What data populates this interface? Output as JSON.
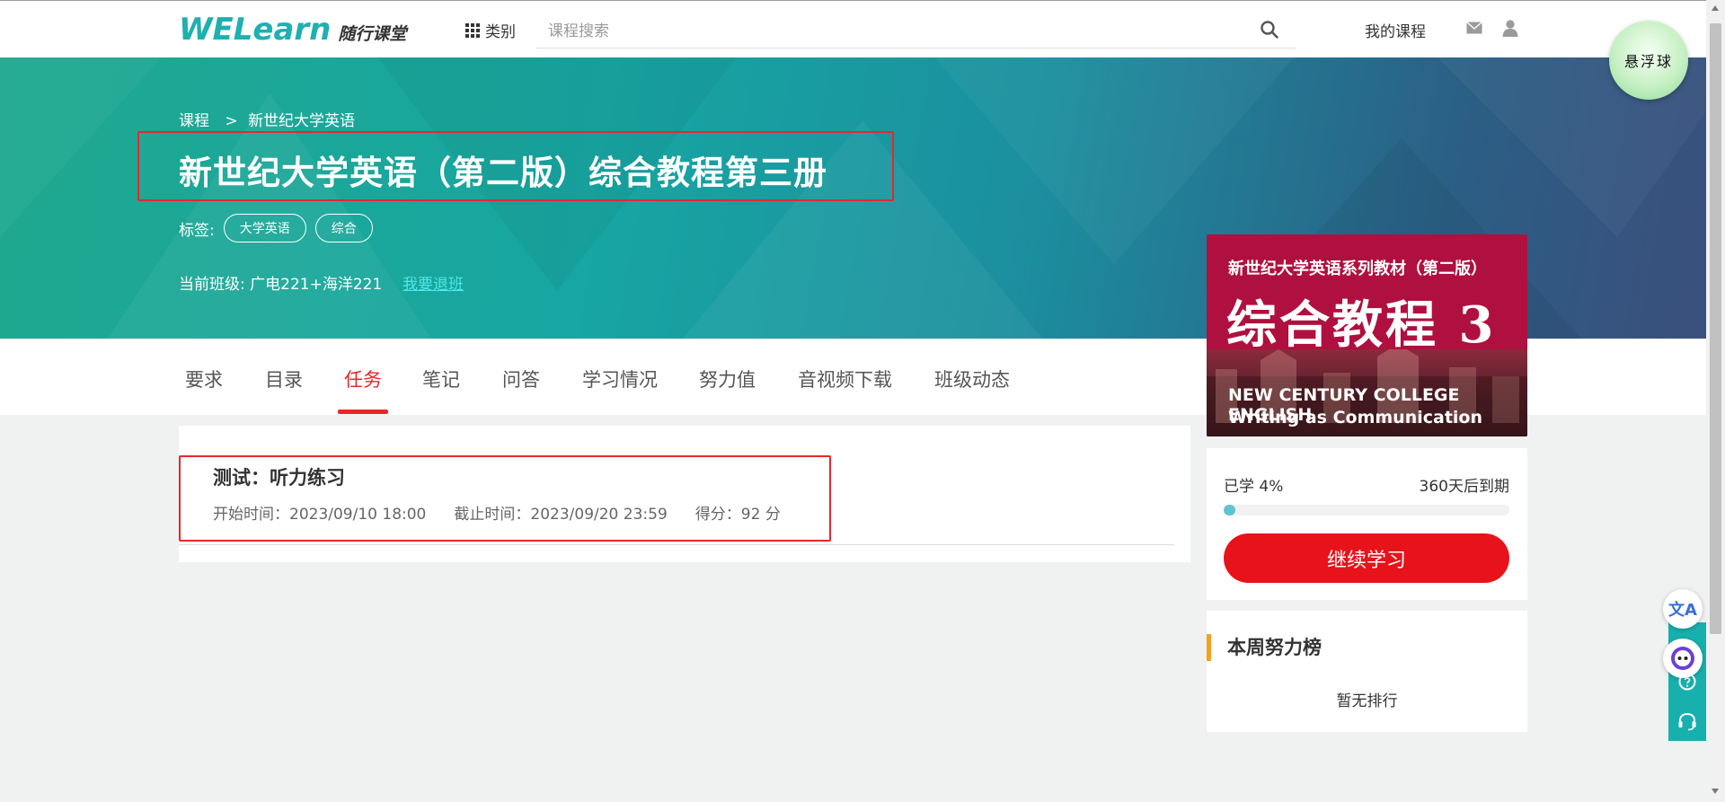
{
  "header": {
    "logo_main": "WELearn",
    "logo_sub": "随行课堂",
    "category_label": "类别",
    "search_placeholder": "课程搜索",
    "my_course": "我的课程",
    "float_ball": "悬浮球"
  },
  "banner": {
    "breadcrumb": {
      "root": "课程",
      "separator": ">",
      "current": "新世纪大学英语"
    },
    "title": "新世纪大学英语（第二版）综合教程第三册",
    "tags_label": "标签:",
    "tags": [
      "大学英语",
      "综合"
    ],
    "class_label": "当前班级: 广电221+海洋221",
    "quit_link": "我要退班"
  },
  "tabs": [
    {
      "label": "要求",
      "active": false
    },
    {
      "label": "目录",
      "active": false
    },
    {
      "label": "任务",
      "active": true
    },
    {
      "label": "笔记",
      "active": false
    },
    {
      "label": "问答",
      "active": false
    },
    {
      "label": "学习情况",
      "active": false
    },
    {
      "label": "努力值",
      "active": false
    },
    {
      "label": "音视频下载",
      "active": false
    },
    {
      "label": "班级动态",
      "active": false
    }
  ],
  "task": {
    "title": "测试：听力练习",
    "start": "开始时间：2023/09/10 18:00",
    "deadline": "截止时间：2023/09/20 23:59",
    "score": "得分：92 分"
  },
  "cover": {
    "series": "新世纪大学英语系列教材（第二版）",
    "big_title": "综合教程 3",
    "en_line1": "NEW CENTURY COLLEGE ENGLISH",
    "en_line2": "Writing as Communication"
  },
  "progress": {
    "learned": "已学 4%",
    "percent": 4,
    "expire": "360天后到期",
    "continue_button": "继续学习"
  },
  "ranking": {
    "title": "本周努力榜",
    "empty": "暂无排行"
  },
  "side": {
    "translate_icon": "文A"
  },
  "colors": {
    "accent_red": "#e8272b",
    "teal": "#17a6a2",
    "progress_fill": "#5fc2d6",
    "rank_bar": "#f5a21a"
  }
}
